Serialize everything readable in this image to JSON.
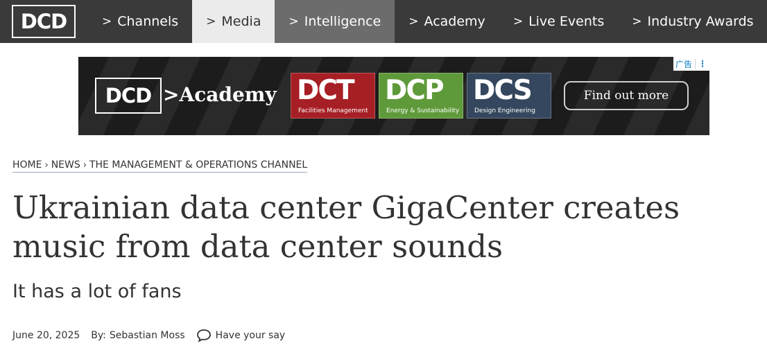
{
  "nav": {
    "logo": "DCD",
    "items": [
      {
        "label": "Channels"
      },
      {
        "label": "Media"
      },
      {
        "label": "Intelligence"
      },
      {
        "label": "Academy"
      },
      {
        "label": "Live Events"
      },
      {
        "label": "Industry Awards"
      }
    ],
    "chevron": ">"
  },
  "ad": {
    "brand": "DCD",
    "chevron": ">",
    "product": "Academy",
    "tiles": [
      {
        "abbr": "DCT",
        "subtitle": "Facilities Management",
        "color": "#a61f24"
      },
      {
        "abbr": "DCP",
        "subtitle": "Energy & Sustainability",
        "color": "#5f9a3a"
      },
      {
        "abbr": "DCS",
        "subtitle": "Design Engineering",
        "color": "#34475e"
      }
    ],
    "cta": "Find out more",
    "badge": "广告"
  },
  "breadcrumb": {
    "items": [
      "HOME",
      "NEWS",
      "THE MANAGEMENT & OPERATIONS CHANNEL"
    ],
    "separator": "›"
  },
  "article": {
    "title": "Ukrainian data center GigaCenter creates music from data center sounds",
    "standfirst": "It has a lot of fans",
    "date": "June 20, 2025",
    "by_label": "By:",
    "author": "Sebastian Moss",
    "comment_label": "Have your say"
  }
}
